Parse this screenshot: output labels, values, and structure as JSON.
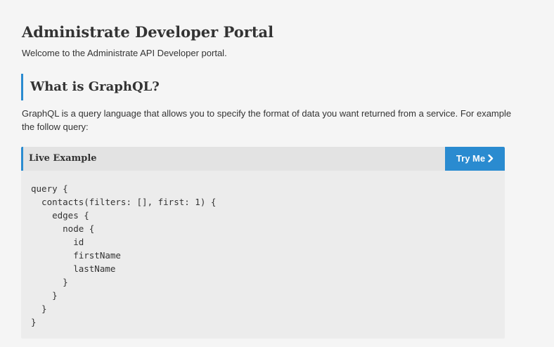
{
  "page": {
    "title": "Administrate Developer Portal",
    "intro": "Welcome to the Administrate API Developer portal."
  },
  "section": {
    "heading": "What is GraphQL?",
    "description": "GraphQL is a query language that allows you to specify the format of data you want returned from a service. For example the follow query:"
  },
  "example": {
    "title": "Live Example",
    "button_label": "Try Me",
    "button_icon": "chevron-right-icon",
    "code_lines": [
      "query {",
      "  contacts(filters: [], first: 1) {",
      "    edges {",
      "      node {",
      "        id",
      "        firstName",
      "        lastName",
      "      }",
      "    }",
      "  }",
      "}"
    ]
  },
  "colors": {
    "accent": "#2a8bd0",
    "background": "#f5f5f5",
    "example_body": "#ececec",
    "example_header": "#e3e3e3",
    "text": "#333333"
  }
}
